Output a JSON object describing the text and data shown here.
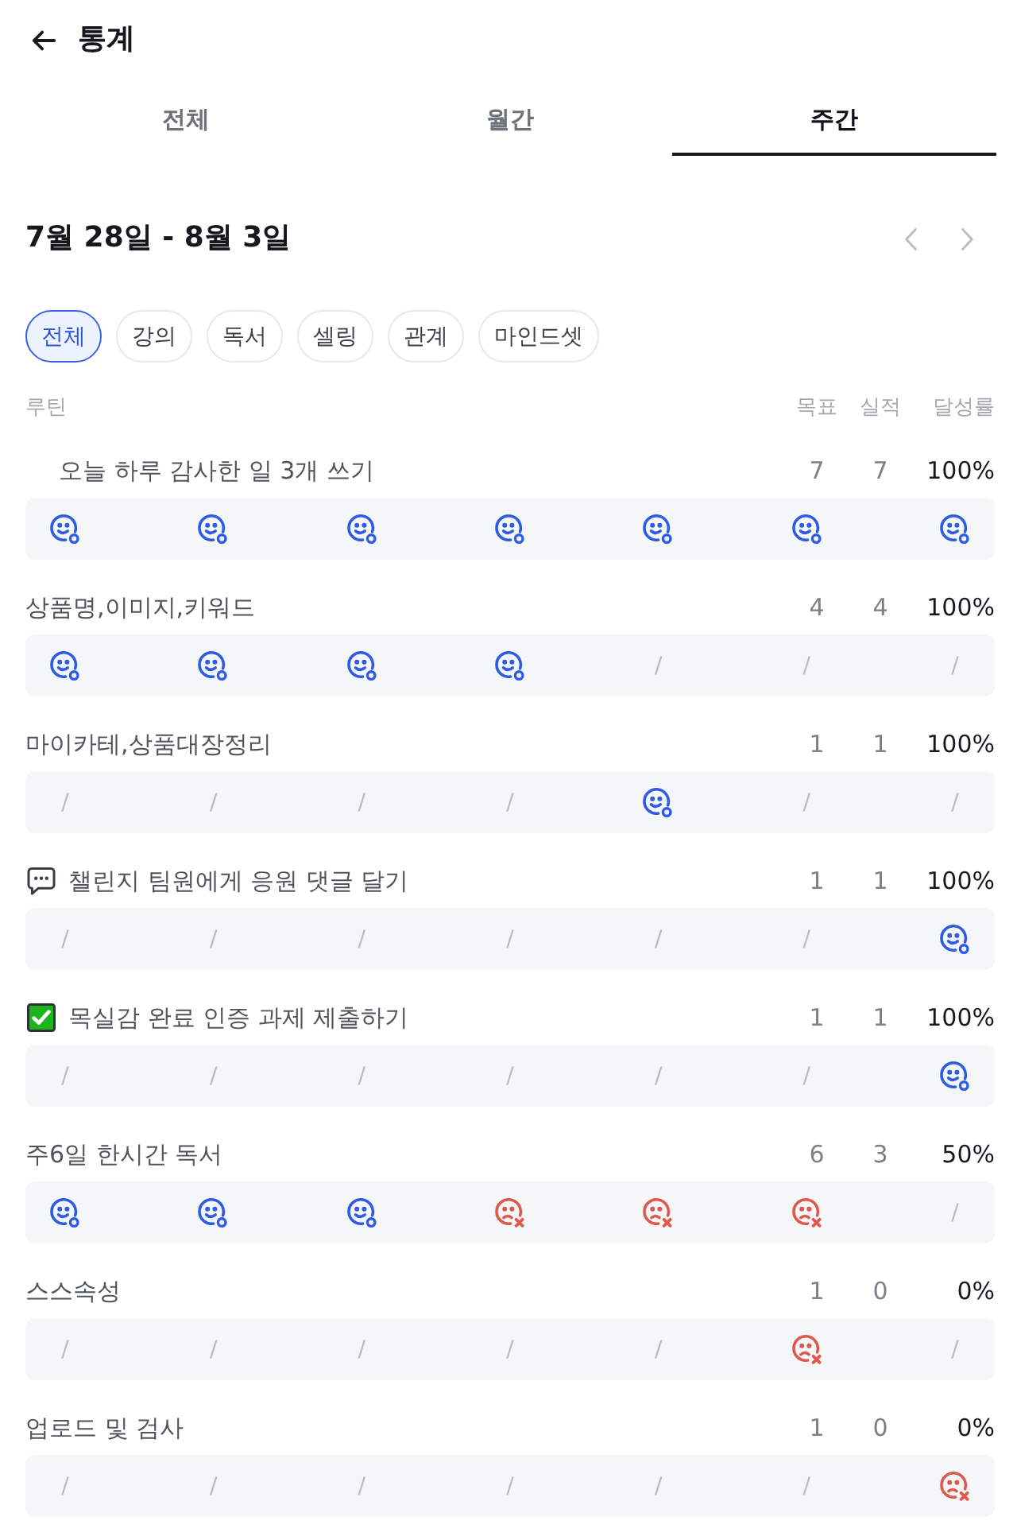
{
  "header": {
    "title": "통계"
  },
  "tabs": [
    {
      "label": "전체",
      "selected": false
    },
    {
      "label": "월간",
      "selected": false
    },
    {
      "label": "주간",
      "selected": true
    }
  ],
  "period": {
    "title": "7월 28일 - 8월 3일"
  },
  "categories": [
    {
      "label": "전체",
      "selected": true
    },
    {
      "label": "강의",
      "selected": false
    },
    {
      "label": "독서",
      "selected": false
    },
    {
      "label": "셀링",
      "selected": false
    },
    {
      "label": "관계",
      "selected": false
    },
    {
      "label": "마인드셋",
      "selected": false
    }
  ],
  "table": {
    "columns": [
      "루틴",
      "목표",
      "실적",
      "달성률"
    ],
    "routines": [
      {
        "kind": "indented",
        "title": "오늘 하루 감사한 일 3개 쓰기",
        "goal": "7",
        "actual": "7",
        "rate": "100%",
        "days": [
          {
            "kind": "done"
          },
          {
            "kind": "done"
          },
          {
            "kind": "done"
          },
          {
            "kind": "done"
          },
          {
            "kind": "done"
          },
          {
            "kind": "done"
          },
          {
            "kind": "done"
          }
        ]
      },
      {
        "kind": "plain",
        "title": "상품명,이미지,키워드",
        "goal": "4",
        "actual": "4",
        "rate": "100%",
        "days": [
          {
            "kind": "done"
          },
          {
            "kind": "done"
          },
          {
            "kind": "done"
          },
          {
            "kind": "done"
          },
          {
            "kind": "empty",
            "text": "/"
          },
          {
            "kind": "empty",
            "text": "/"
          },
          {
            "kind": "empty",
            "text": "/"
          }
        ]
      },
      {
        "kind": "plain",
        "title": "마이카테,상품대장정리",
        "goal": "1",
        "actual": "1",
        "rate": "100%",
        "days": [
          {
            "kind": "empty",
            "text": "/"
          },
          {
            "kind": "empty",
            "text": "/"
          },
          {
            "kind": "empty",
            "text": "/"
          },
          {
            "kind": "empty",
            "text": "/"
          },
          {
            "kind": "done"
          },
          {
            "kind": "empty",
            "text": "/"
          },
          {
            "kind": "empty",
            "text": "/"
          }
        ]
      },
      {
        "kind": "comment",
        "title": "챌린지 팀원에게 응원 댓글 달기",
        "goal": "1",
        "actual": "1",
        "rate": "100%",
        "days": [
          {
            "kind": "empty",
            "text": "/"
          },
          {
            "kind": "empty",
            "text": "/"
          },
          {
            "kind": "empty",
            "text": "/"
          },
          {
            "kind": "empty",
            "text": "/"
          },
          {
            "kind": "empty",
            "text": "/"
          },
          {
            "kind": "empty",
            "text": "/"
          },
          {
            "kind": "done"
          }
        ]
      },
      {
        "kind": "task",
        "title": "목실감 완료 인증 과제 제출하기",
        "goal": "1",
        "actual": "1",
        "rate": "100%",
        "days": [
          {
            "kind": "empty",
            "text": "/"
          },
          {
            "kind": "empty",
            "text": "/"
          },
          {
            "kind": "empty",
            "text": "/"
          },
          {
            "kind": "empty",
            "text": "/"
          },
          {
            "kind": "empty",
            "text": "/"
          },
          {
            "kind": "empty",
            "text": "/"
          },
          {
            "kind": "done"
          }
        ]
      },
      {
        "kind": "plain",
        "title": "주6일 한시간 독서",
        "goal": "6",
        "actual": "3",
        "rate": "50%",
        "days": [
          {
            "kind": "done"
          },
          {
            "kind": "done"
          },
          {
            "kind": "done"
          },
          {
            "kind": "missed"
          },
          {
            "kind": "missed"
          },
          {
            "kind": "missed"
          },
          {
            "kind": "empty",
            "text": "/"
          }
        ]
      },
      {
        "kind": "plain",
        "title": "스스속성",
        "goal": "1",
        "actual": "0",
        "rate": "0%",
        "days": [
          {
            "kind": "empty",
            "text": "/"
          },
          {
            "kind": "empty",
            "text": "/"
          },
          {
            "kind": "empty",
            "text": "/"
          },
          {
            "kind": "empty",
            "text": "/"
          },
          {
            "kind": "empty",
            "text": "/"
          },
          {
            "kind": "missed"
          },
          {
            "kind": "empty",
            "text": "/"
          }
        ]
      },
      {
        "kind": "plain",
        "title": "업로드 및 검사",
        "goal": "1",
        "actual": "0",
        "rate": "0%",
        "days": [
          {
            "kind": "empty",
            "text": "/"
          },
          {
            "kind": "empty",
            "text": "/"
          },
          {
            "kind": "empty",
            "text": "/"
          },
          {
            "kind": "empty",
            "text": "/"
          },
          {
            "kind": "empty",
            "text": "/"
          },
          {
            "kind": "empty",
            "text": "/"
          },
          {
            "kind": "missed"
          }
        ]
      }
    ]
  }
}
